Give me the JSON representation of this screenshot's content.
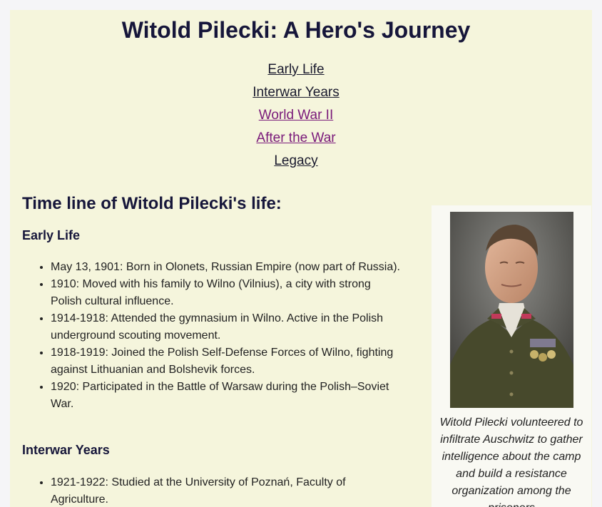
{
  "page": {
    "title": "Witold Pilecki: A Hero's Journey"
  },
  "nav": {
    "items": [
      {
        "label": "Early Life"
      },
      {
        "label": "Interwar Years"
      },
      {
        "label": "World War II"
      },
      {
        "label": "After the War"
      },
      {
        "label": "Legacy"
      }
    ]
  },
  "timeline": {
    "heading": "Time line of Witold Pilecki's life:",
    "sections": [
      {
        "title": "Early Life",
        "events": [
          "May 13, 1901: Born in Olonets, Russian Empire (now part of Russia).",
          "1910: Moved with his family to Wilno (Vilnius), a city with strong Polish cultural influence.",
          "1914-1918: Attended the gymnasium in Wilno. Active in the Polish underground scouting movement.",
          "1918-1919: Joined the Polish Self-Defense Forces of Wilno, fighting against Lithuanian and Bolshevik forces.",
          "1920: Participated in the Battle of Warsaw during the Polish–Soviet War."
        ]
      },
      {
        "title": "Interwar Years",
        "events": [
          "1921-1922: Studied at the University of Poznań, Faculty of Agriculture."
        ]
      }
    ]
  },
  "figure": {
    "caption": "Witold Pilecki volunteered to infiltrate Auschwitz to gather intelligence about the camp and build a resistance organization among the prisoners"
  }
}
